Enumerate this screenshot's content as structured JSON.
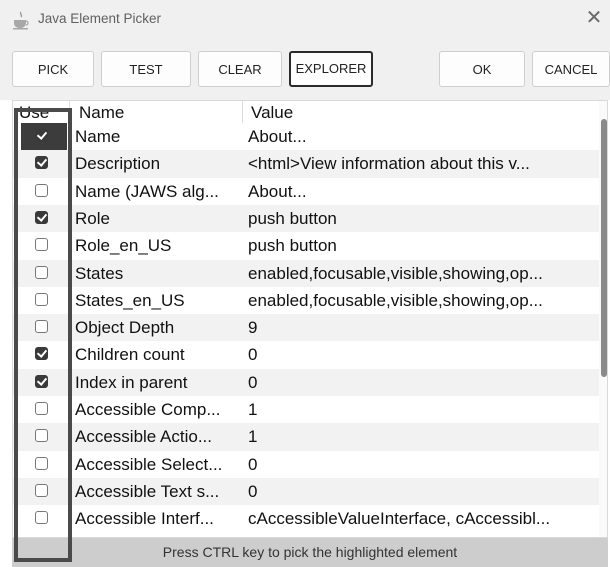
{
  "window": {
    "title": "Java Element Picker",
    "close_icon": "close-icon"
  },
  "toolbar": {
    "buttons": [
      {
        "label": "PICK"
      },
      {
        "label": "TEST"
      },
      {
        "label": "CLEAR"
      },
      {
        "label": "EXPLORER"
      },
      {
        "label": "OK"
      },
      {
        "label": "CANCEL"
      }
    ]
  },
  "table": {
    "headers": {
      "use": "Use",
      "name": "Name",
      "value": "Value"
    },
    "rows": [
      {
        "checked": true,
        "selected": true,
        "name": "Name",
        "value": "About..."
      },
      {
        "checked": true,
        "selected": false,
        "name": "Description",
        "value": "<html>View information about this v..."
      },
      {
        "checked": false,
        "selected": false,
        "name": "Name (JAWS alg...",
        "value": "About..."
      },
      {
        "checked": true,
        "selected": false,
        "name": "Role",
        "value": "push button"
      },
      {
        "checked": false,
        "selected": false,
        "name": "Role_en_US",
        "value": "push button"
      },
      {
        "checked": false,
        "selected": false,
        "name": "States",
        "value": "enabled,focusable,visible,showing,op..."
      },
      {
        "checked": false,
        "selected": false,
        "name": "States_en_US",
        "value": "enabled,focusable,visible,showing,op..."
      },
      {
        "checked": false,
        "selected": false,
        "name": "Object Depth",
        "value": "9"
      },
      {
        "checked": true,
        "selected": false,
        "name": "Children count",
        "value": "0"
      },
      {
        "checked": true,
        "selected": false,
        "name": "Index in parent",
        "value": "0"
      },
      {
        "checked": false,
        "selected": false,
        "name": "Accessible Comp...",
        "value": "1"
      },
      {
        "checked": false,
        "selected": false,
        "name": "Accessible Actio...",
        "value": "1"
      },
      {
        "checked": false,
        "selected": false,
        "name": "Accessible Select...",
        "value": "0"
      },
      {
        "checked": false,
        "selected": false,
        "name": "Accessible Text s...",
        "value": "0"
      },
      {
        "checked": false,
        "selected": false,
        "name": "Accessible Interf...",
        "value": "cAccessibleValueInterface, cAccessibl..."
      }
    ]
  },
  "status": {
    "text": "Press CTRL key to pick the highlighted element"
  },
  "colors": {
    "selection": "#3c3c3c",
    "status_bar": "#cdcdcd",
    "highlight_border": "#4a4a4a"
  }
}
